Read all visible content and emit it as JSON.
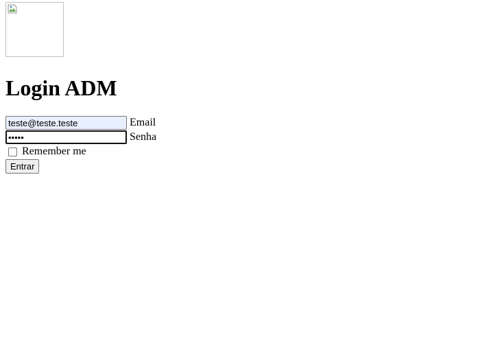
{
  "logo": {
    "icon": "broken-image-icon"
  },
  "page": {
    "title": "Login ADM"
  },
  "form": {
    "email": {
      "value": "teste@teste.teste",
      "label": "Email"
    },
    "password": {
      "value": "•••••",
      "label": "Senha"
    },
    "remember": {
      "label": "Remember me",
      "checked": false
    },
    "submit_label": "Entrar"
  },
  "colors": {
    "autofill_background": "#e8f0fe",
    "button_background": "#efefef"
  }
}
